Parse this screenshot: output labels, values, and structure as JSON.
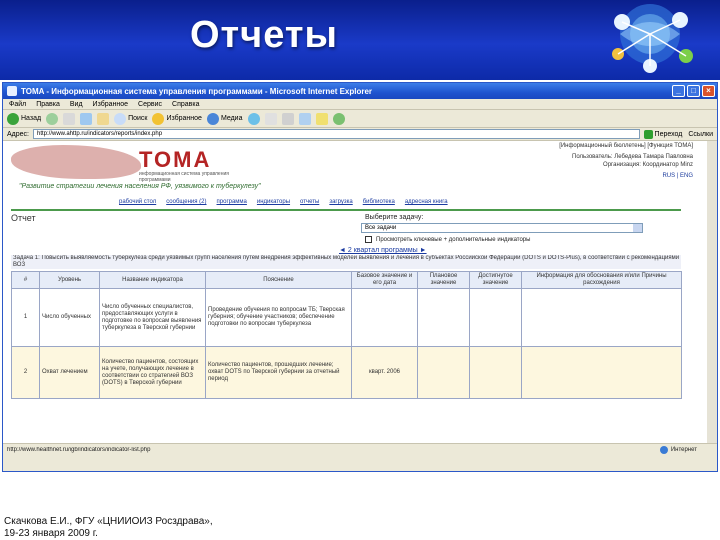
{
  "slide": {
    "title": "Отчеты",
    "caption": [
      "Скачкова Е.И., ФГУ «ЦНИИОИЗ Росздрава»,",
      "19-23 января 2009 г."
    ]
  },
  "browser": {
    "window_title": "TOMA - Информационная система управления программами - Microsoft Internet Explorer",
    "menu": [
      "Файл",
      "Правка",
      "Вид",
      "Избранное",
      "Сервис",
      "Справка"
    ],
    "toolbar": {
      "back": "Назад",
      "search": "Поиск",
      "favorites": "Избранное",
      "media": "Медиа"
    },
    "address_label": "Адрес:",
    "address_value": "http://www.ahttp.ru/indicators/reports/index.php",
    "go_label": "Переход",
    "links_label": "Ссылки",
    "status_url": "http://www.healthnet.ru/igb/indicators/indicator-list.php",
    "status_zone": "Интернет"
  },
  "page": {
    "top_links": "[Информационный бюллетень] [Функция ТОМА]",
    "user_info": "Пользователь: Лебедева Тамара Павловна",
    "user_info2": "Организация: Координатор Minz",
    "lang": "RUS | ENG",
    "logo": "TOMA",
    "logo_sub": "информационная система управления программами",
    "slogan": "\"Развитие стратегии лечения населения РФ, уязвимого к туберкулезу\"",
    "nav": [
      "рабочий стол",
      "сообщения (2)",
      "программа",
      "индикаторы",
      "отчеты",
      "загрузка",
      "библиотека",
      "адресная книга"
    ],
    "report_heading": "Отчет",
    "task_label": "Выберите задачу:",
    "task_value": "Все задачи",
    "show_indicators": "Просмотреть ключевые + дополнительные индикаторы",
    "program_nav": "◄ 2 квартал программы ►",
    "task_description": "Задача 1: Повысить выявляемость туберкулеза среди уязвимых групп населения путем внедрения эффективных моделей выявления и лечения в субъектах Российской Федерации (DOTS и DOTS-Plus), в соответствии с рекомендациями ВОЗ"
  },
  "table": {
    "headers": [
      "#",
      "Уровень",
      "Название индикатора",
      "Пояснение",
      "Базовое значение и его дата",
      "Плановое значение",
      "Достигнутое значение",
      "Информация для обоснования и/или Причины расхождения"
    ],
    "rows": [
      {
        "num": "1",
        "level": "Число обученных",
        "name": "Число обученных специалистов, предоставляющих услуги в подготовке по вопросам выявления туберкулеза в Тверской губернии",
        "explanation": "Проведение обучения по вопросам ТБ; Тверская губерния; обучение участников; обеспечение подготовки по вопросам туберкулеза",
        "base": "",
        "plan": "",
        "achieved": ""
      },
      {
        "num": "2",
        "level": "Охват лечением",
        "name": "Количество пациентов, состоящих на учете, получающих лечение в соответствии со стратегией ВОЗ (DOTS) в Тверской губернии",
        "explanation": "Количество пациентов, прошедших лечение; охват DOTS по Тверской губернии за отчетный период",
        "base": "кварт. 2006",
        "plan": "",
        "achieved": ""
      }
    ]
  }
}
